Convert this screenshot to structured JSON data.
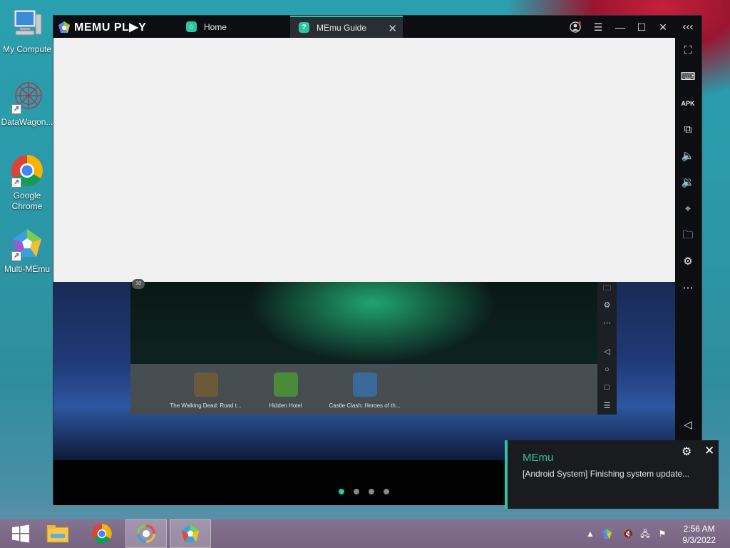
{
  "desktop": {
    "icons": [
      {
        "label": "My Compute",
        "icon": "computer-icon"
      },
      {
        "label": "DataWagon...",
        "icon": "datawagon-icon"
      },
      {
        "label": "Google Chrome",
        "icon": "chrome-icon"
      },
      {
        "label": "Multi-MEmu",
        "icon": "multi-memu-icon"
      }
    ]
  },
  "memu": {
    "brand": "MEMU PL▶Y",
    "tabs": [
      {
        "label": "Home",
        "icon": "home-tab-icon"
      },
      {
        "label": "MEmu Guide",
        "icon": "guide-tab-icon"
      }
    ],
    "controls": [
      "account-icon",
      "menu-icon",
      "minimize-icon",
      "maximize-icon",
      "close-icon",
      "collapse-sidebar-icon"
    ],
    "sidebar": [
      "fullscreen-icon",
      "keyboard-icon",
      "apk-icon",
      "multi-window-icon",
      "volume-up-icon",
      "volume-down-icon",
      "location-icon",
      "folder-icon",
      "settings-icon",
      "more-icon",
      "back-icon"
    ],
    "inner": {
      "age_badge": "18",
      "dock_apps": [
        {
          "label": "The Walking Dead: Road t...",
          "color": "#6b5a3a"
        },
        {
          "label": "Hidden Hotel",
          "color": "#4a8a3a"
        },
        {
          "label": "Castle Clash: Heroes of th...",
          "color": "#3a6a9a"
        }
      ]
    },
    "page_dots": 4,
    "active_dot": 0
  },
  "notification": {
    "title": "MEmu",
    "message": "[Android System] Finishing system update..."
  },
  "taskbar": {
    "apps": [
      "windows-start-icon",
      "file-explorer-icon",
      "chrome-icon",
      "multi-memu-icon",
      "memu-icon"
    ],
    "tray": [
      "show-hidden-icon",
      "memu-tray-icon",
      "volume-muted-icon",
      "network-icon",
      "action-center-icon"
    ],
    "time": "2:56 AM",
    "date": "9/3/2022"
  },
  "colors": {
    "accent": "#2ec4a0",
    "titlebar": "#0d0e12"
  }
}
